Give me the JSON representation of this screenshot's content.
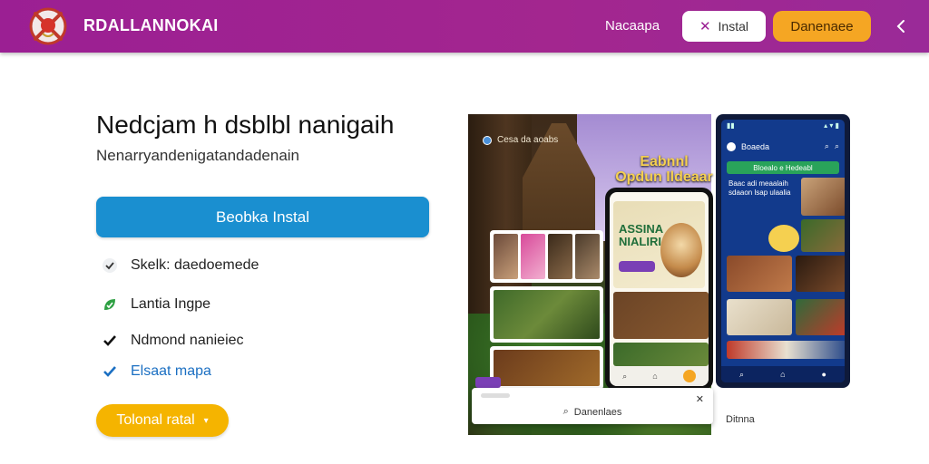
{
  "header": {
    "brand": "RDALLANNOKAI",
    "nav_link": "Nacaapa",
    "install_label": "Instal",
    "donate_label": "Danenaee",
    "colors": {
      "bar": "#9b1f93",
      "donate": "#f5a623"
    },
    "icons": [
      "logo-emblem",
      "share-icon"
    ]
  },
  "main": {
    "title": "Nedcjam h dsblbl nanigaih",
    "subtitle": "Nenarryandenigatandadenain",
    "primary_button": "Beobka Instal",
    "features": [
      {
        "label": "Skelk: daedoemede",
        "icon": "check-icon"
      },
      {
        "label": "Lantia Ingpe",
        "icon": "leaf-check-icon"
      },
      {
        "label": "Ndmond nanieiec",
        "icon": "check-icon"
      },
      {
        "label": "Elsaat mapa",
        "icon": "check-icon"
      }
    ],
    "tutorial_button": "Tolonal ratal",
    "tutorial_icon": "chevron-down-icon"
  },
  "preview": {
    "scene_label": "Cesa da aoabs",
    "headline_line1": "Eabnnl",
    "headline_line2": "Opdun Ildeaar",
    "phone_front": {
      "hero_line1": "ASSINA",
      "hero_line2": "NIALIRIA",
      "nav_icons": [
        "search-icon",
        "home-icon",
        "profile-icon"
      ]
    },
    "phone_back": {
      "app_title": "Boaeda",
      "tab_label": "Bloealo e Hedeabl",
      "intro_text": "Baac adi meaalaih sdaaon lsap ulaalia",
      "nav_icons": [
        "search-icon",
        "home-icon",
        "profile-icon"
      ]
    },
    "popup_search": "Danenlaes",
    "caption": "Ditnna"
  }
}
